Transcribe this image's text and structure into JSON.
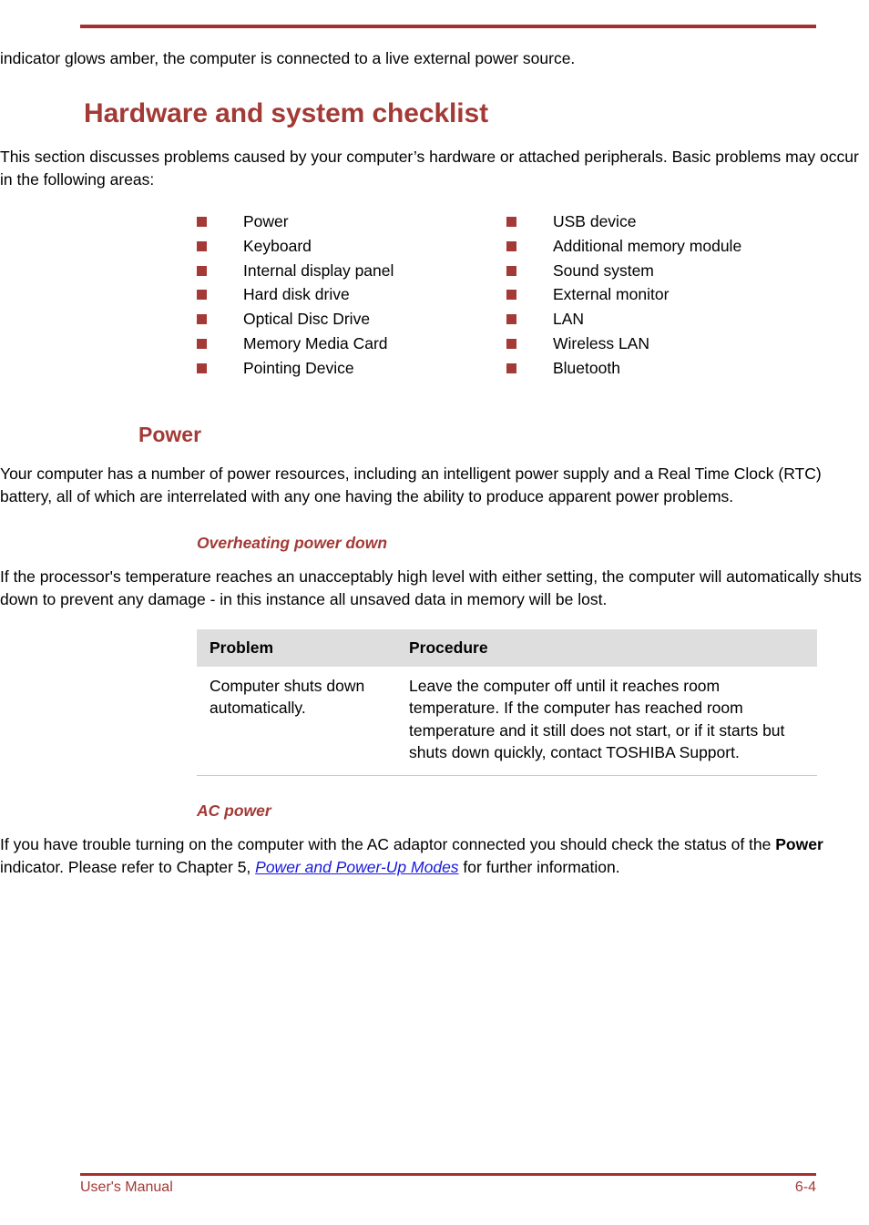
{
  "page": {
    "footer_left": "User's Manual",
    "footer_right": "6-4",
    "accent_color": "#A33A36",
    "rule_color": "#A33030",
    "link_color": "#1A1AE0",
    "table_header_bg": "#DEDEDE"
  },
  "intro": {
    "continuation_paragraph": "indicator glows amber, the computer is connected to a live external power source."
  },
  "section": {
    "heading": "Hardware and system checklist",
    "paragraph": "This section discusses problems caused by your computer’s hardware or attached peripherals. Basic problems may occur in the following areas:"
  },
  "checklist": {
    "left_column": [
      "Power",
      "Keyboard",
      "Internal display panel",
      "Hard disk drive",
      "Optical Disc Drive",
      "Memory Media Card",
      "Pointing Device"
    ],
    "right_column": [
      "USB device",
      "Additional memory module",
      "Sound system",
      "External monitor",
      "LAN",
      "Wireless LAN",
      "Bluetooth"
    ]
  },
  "power_section": {
    "heading": "Power",
    "paragraph": "Your computer has a number of power resources, including an intelligent power supply and a Real Time Clock (RTC) battery, all of which are interrelated with any one having the ability to produce apparent power problems."
  },
  "overheating": {
    "heading": "Overheating power down",
    "paragraph": "If the processor's temperature reaches an unacceptably high level with either setting, the computer will automatically shuts down to prevent any damage - in this instance all unsaved data in memory will be lost.",
    "table": {
      "headers": [
        "Problem",
        "Procedure"
      ],
      "rows": [
        {
          "problem": "Computer shuts down automatically.",
          "procedure": "Leave the computer off until it reaches room temperature. If the computer has reached room temperature and it still does not start, or if it starts but shuts down quickly, contact TOSHIBA Support."
        }
      ]
    }
  },
  "ac_power": {
    "heading": "AC power",
    "text_part1": "If you have trouble turning on the computer with the AC adaptor connected you should check the status of the ",
    "bold_term": "Power",
    "text_part2": " indicator. Please refer to Chapter 5, ",
    "link_text": "Power and Power-Up Modes",
    "text_part3": " for further information."
  }
}
